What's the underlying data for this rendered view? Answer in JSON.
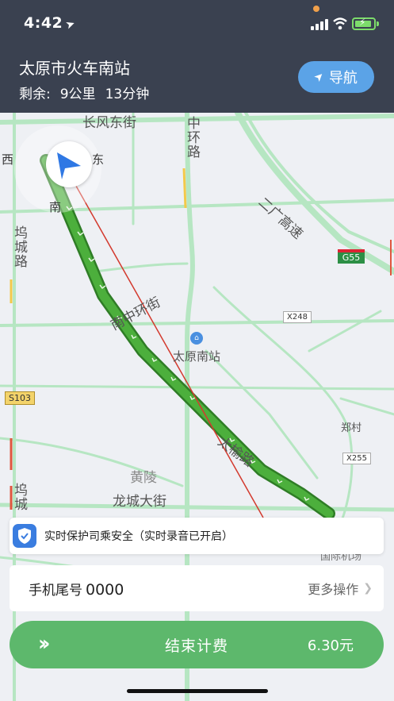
{
  "status": {
    "time": "4:42"
  },
  "header": {
    "destination": "太原市火车南站",
    "remaining_label": "剩余:",
    "distance": "9公里",
    "duration": "13分钟",
    "nav_button": "导航"
  },
  "map": {
    "compass": {
      "west": "西",
      "east": "东",
      "south": "南"
    },
    "labels": {
      "changfeng": "长风东街",
      "zhonghuan": "中环路",
      "erguang": "二广高速",
      "wucheng_top": "坞城路",
      "nanzhonghuan": "南中环街",
      "station": "太原南站",
      "taiyu": "太榆路",
      "zhengcun": "郑村",
      "huangling": "黄陵",
      "longcheng": "龙城大街",
      "wucheng_bottom": "坞城",
      "airport": "国际机场"
    },
    "badges": {
      "g55": "G55",
      "x248": "X248",
      "s103": "S103",
      "x255": "X255"
    }
  },
  "safety": {
    "text": "实时保护司乘安全（实时录音已开启）"
  },
  "phone": {
    "label": "手机尾号",
    "tail": "0000",
    "more": "更多操作"
  },
  "action": {
    "end_label": "结束计费",
    "fare": "6.30元"
  },
  "colors": {
    "header_bg": "#3a4150",
    "nav_blue": "#5ba3e7",
    "action_green": "#5db86c",
    "route_green": "#4caf3c"
  }
}
